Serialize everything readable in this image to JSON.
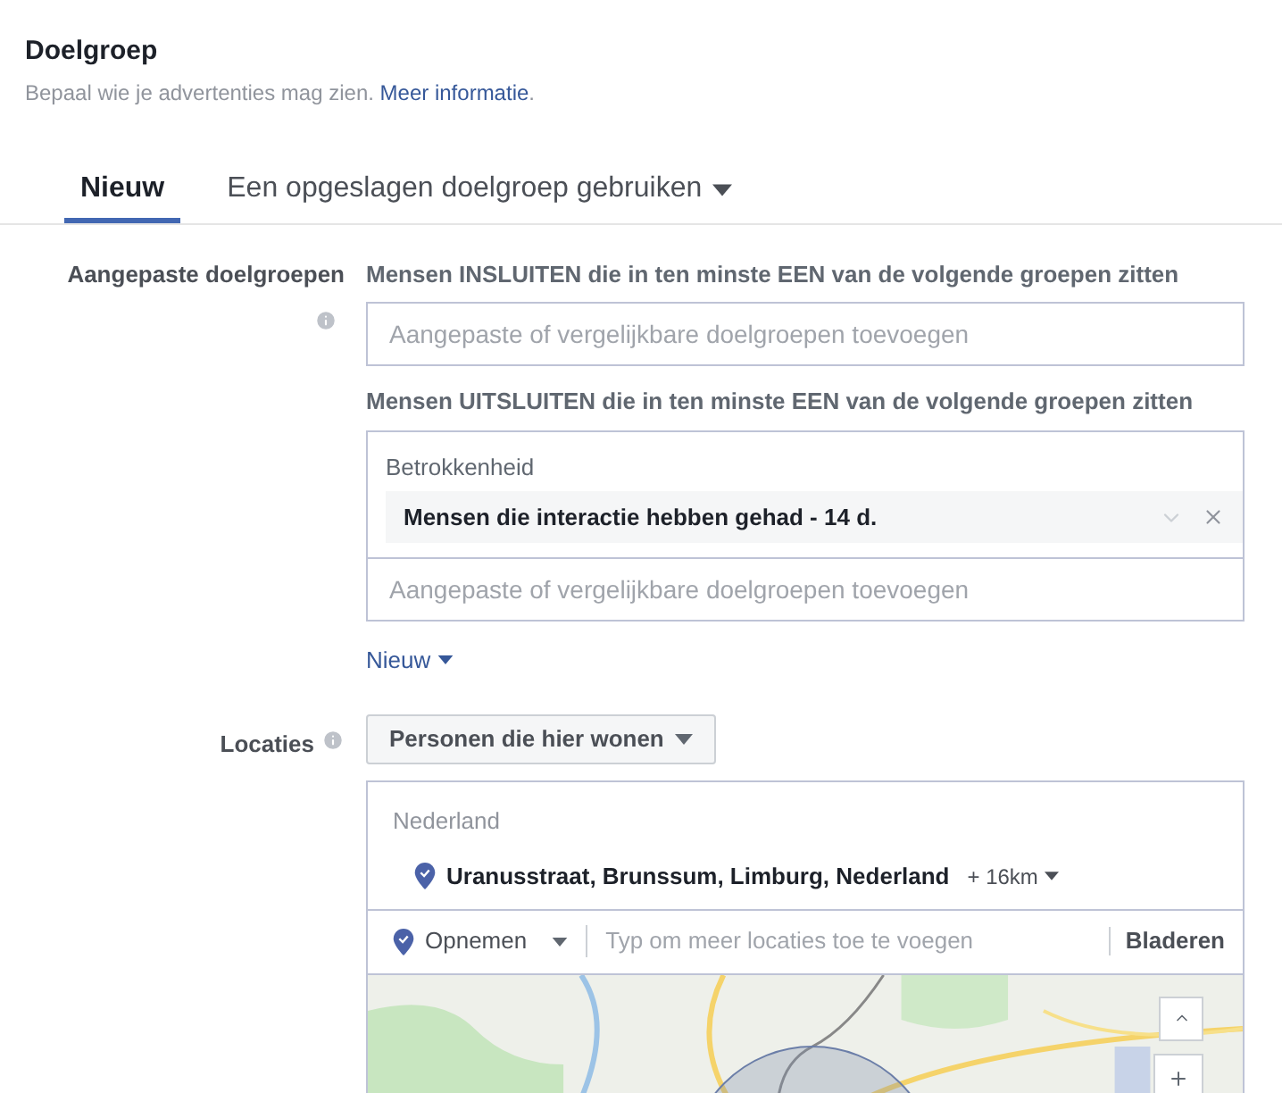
{
  "header": {
    "title": "Doelgroep",
    "description": "Bepaal wie je advertenties mag zien.",
    "link": "Meer informatie",
    "after_link": "."
  },
  "tabs": [
    {
      "label": "Nieuw",
      "selected": true,
      "kind": "plain"
    },
    {
      "label": "Een opgeslagen doelgroep gebruiken",
      "selected": false,
      "kind": "dropdown"
    }
  ],
  "custom_audiences": {
    "label": "Aangepaste doelgroepen",
    "include_heading": "Mensen INSLUITEN die in ten minste EEN van de volgende groepen zitten",
    "include_field": {
      "placeholder": "Aangepaste of vergelijkbare doelgroepen toevoegen"
    },
    "exclude_heading": "Mensen UITSLUITEN die in ten minste EEN van de volgende groepen zitten",
    "exclude_group": {
      "title": "Betrokkenheid",
      "items": [
        {
          "text": "Mensen die interactie hebben gehad - 14 d."
        }
      ]
    },
    "exclude_field": {
      "placeholder": "Aangepaste of vergelijkbare doelgroepen toevoegen"
    },
    "new_link": "Nieuw"
  },
  "locations": {
    "label": "Locaties",
    "type_select": "Personen die hier wonen",
    "country": "Nederland",
    "items": [
      {
        "text": "Uranusstraat, Brunssum, Limburg, Nederland",
        "radius": "+ 16km"
      }
    ],
    "mode": "Opnemen",
    "search": {
      "placeholder": "Typ om meer locaties toe te voegen"
    },
    "browse": "Bladeren"
  }
}
